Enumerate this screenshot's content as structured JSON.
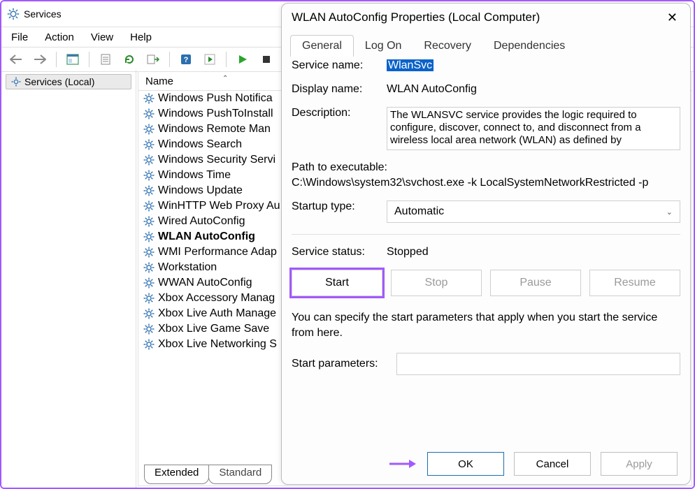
{
  "servicesWindow": {
    "title": "Services",
    "menu": {
      "file": "File",
      "action": "Action",
      "view": "View",
      "help": "Help"
    },
    "tree": {
      "root": "Services (Local)"
    },
    "listHeader": "Name",
    "services": [
      "Windows Push Notifica",
      "Windows PushToInstall",
      "Windows Remote Man",
      "Windows Search",
      "Windows Security Servi",
      "Windows Time",
      "Windows Update",
      "WinHTTP Web Proxy Au",
      "Wired AutoConfig",
      "WLAN AutoConfig",
      "WMI Performance Adap",
      "Workstation",
      "WWAN AutoConfig",
      "Xbox Accessory Manag",
      "Xbox Live Auth Manage",
      "Xbox Live Game Save",
      "Xbox Live Networking S"
    ],
    "bottomTabs": {
      "extended": "Extended",
      "standard": "Standard"
    }
  },
  "dialog": {
    "title": "WLAN AutoConfig Properties (Local Computer)",
    "tabs": {
      "general": "General",
      "logon": "Log On",
      "recovery": "Recovery",
      "deps": "Dependencies"
    },
    "labels": {
      "serviceName": "Service name:",
      "displayName": "Display name:",
      "description": "Description:",
      "pathLabel": "Path to executable:",
      "startupType": "Startup type:",
      "serviceStatus": "Service status:",
      "startParams": "Start parameters:"
    },
    "values": {
      "serviceName": "WlanSvc",
      "displayName": "WLAN AutoConfig",
      "description": "The WLANSVC service provides the logic required to configure, discover, connect to, and disconnect from a wireless local area network (WLAN) as defined by",
      "path": "C:\\Windows\\system32\\svchost.exe -k LocalSystemNetworkRestricted -p",
      "startupType": "Automatic",
      "status": "Stopped"
    },
    "buttons": {
      "start": "Start",
      "stop": "Stop",
      "pause": "Pause",
      "resume": "Resume"
    },
    "note": "You can specify the start parameters that apply when you start the service from here.",
    "footer": {
      "ok": "OK",
      "cancel": "Cancel",
      "apply": "Apply"
    }
  }
}
